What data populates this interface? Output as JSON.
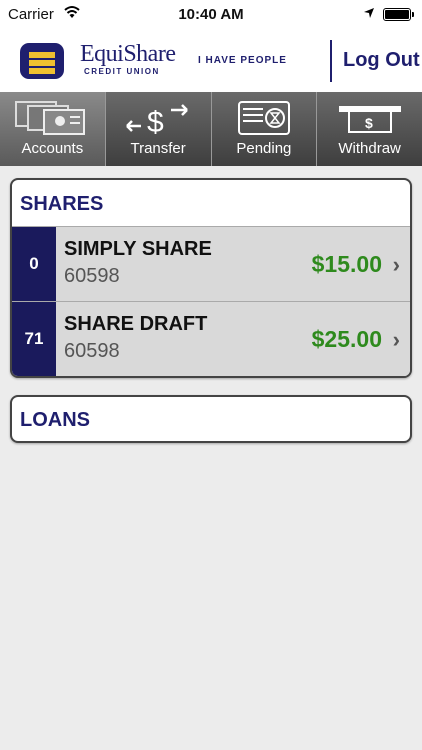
{
  "status_bar": {
    "carrier": "Carrier",
    "time": "10:40 AM",
    "wifi_icon": "wifi-icon",
    "location_icon": "location-arrow-icon",
    "battery_icon": "battery-icon"
  },
  "header": {
    "brand_name": "EquiShare",
    "brand_sub": "CREDIT UNION",
    "tagline": "I HAVE PEOPLE",
    "logout_label": "Log Out",
    "brand_color": "#1f1f6e"
  },
  "tabs": [
    {
      "label": "Accounts",
      "icon": "cards-icon",
      "active": true
    },
    {
      "label": "Transfer",
      "icon": "transfer-dollar-icon",
      "active": false
    },
    {
      "label": "Pending",
      "icon": "pending-check-icon",
      "active": false
    },
    {
      "label": "Withdraw",
      "icon": "withdraw-cash-icon",
      "active": false
    }
  ],
  "shares": {
    "title": "SHARES",
    "rows": [
      {
        "count": "0",
        "name": "SIMPLY SHARE",
        "account": "60598",
        "amount": "$15.00"
      },
      {
        "count": "71",
        "name": "SHARE DRAFT",
        "account": "60598",
        "amount": "$25.00"
      }
    ]
  },
  "loans": {
    "title": "LOANS"
  },
  "colors": {
    "amount_green": "#2e8a1d",
    "count_bg": "#1a1a5c"
  }
}
